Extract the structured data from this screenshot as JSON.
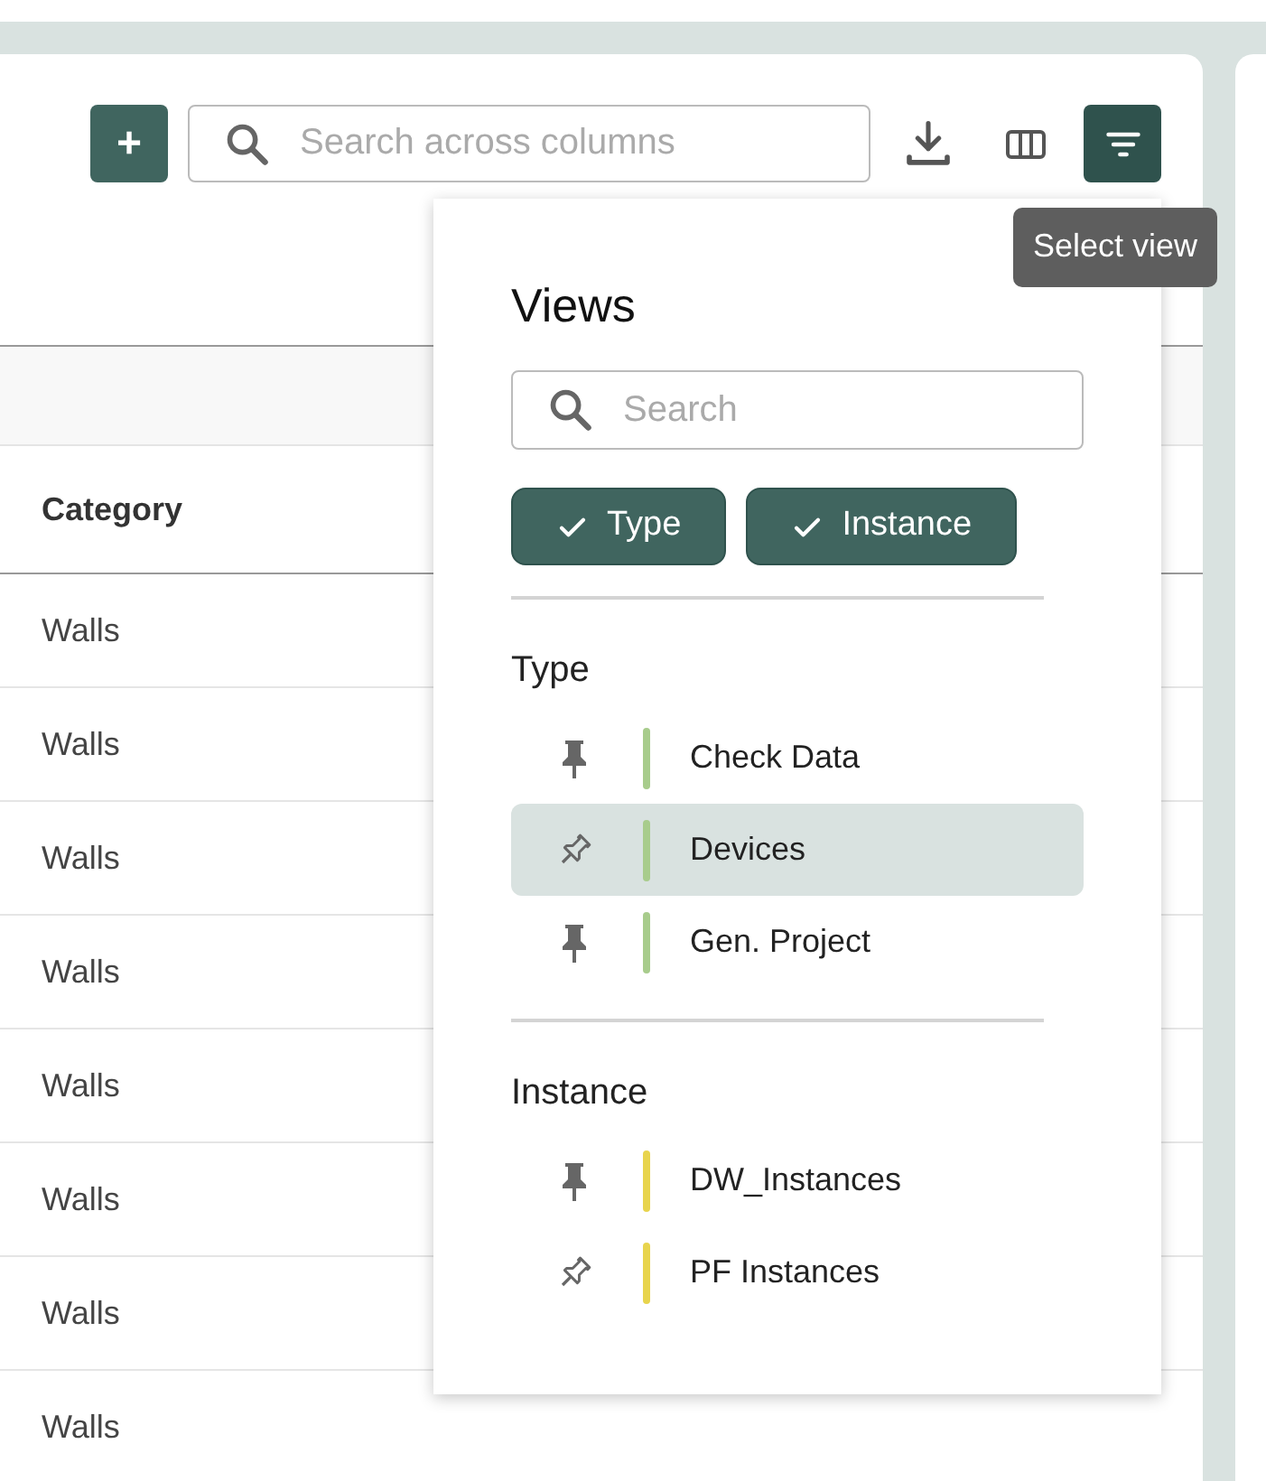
{
  "toolbar": {
    "add_label": "+",
    "search": {
      "placeholder": "Search across columns"
    },
    "view_button_selected": true,
    "tooltip": "Select view"
  },
  "table": {
    "columns": [
      {
        "label": "Category"
      }
    ],
    "rows": [
      {
        "category": "Walls"
      },
      {
        "category": "Walls"
      },
      {
        "category": "Walls"
      },
      {
        "category": "Walls"
      },
      {
        "category": "Walls"
      },
      {
        "category": "Walls"
      },
      {
        "category": "Walls"
      },
      {
        "category": "Walls"
      }
    ]
  },
  "views_panel": {
    "title": "Views",
    "search": {
      "placeholder": "Search"
    },
    "filters": [
      {
        "label": "Type",
        "checked": true
      },
      {
        "label": "Instance",
        "checked": true
      }
    ],
    "groups": [
      {
        "name": "Type",
        "items": [
          {
            "label": "Check Data",
            "pinned": true,
            "selected": false,
            "color": "#a8cc8c"
          },
          {
            "label": "Devices",
            "pinned": false,
            "selected": true,
            "color": "#a8cc8c"
          },
          {
            "label": "Gen. Project",
            "pinned": true,
            "selected": false,
            "color": "#a8cc8c"
          }
        ]
      },
      {
        "name": "Instance",
        "items": [
          {
            "label": "DW_Instances",
            "pinned": true,
            "selected": false,
            "color": "#e8d44d"
          },
          {
            "label": "PF Instances",
            "pinned": false,
            "selected": false,
            "color": "#e8d44d"
          }
        ]
      }
    ]
  }
}
